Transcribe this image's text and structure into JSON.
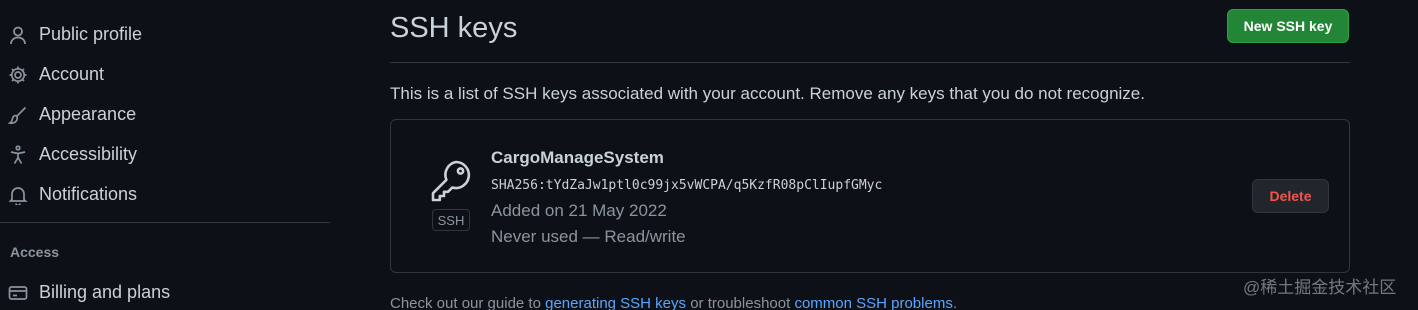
{
  "sidebar": {
    "items": [
      {
        "label": "Public profile",
        "icon": "person-icon"
      },
      {
        "label": "Account",
        "icon": "gear-icon"
      },
      {
        "label": "Appearance",
        "icon": "paintbrush-icon"
      },
      {
        "label": "Accessibility",
        "icon": "accessibility-icon"
      },
      {
        "label": "Notifications",
        "icon": "bell-icon"
      }
    ],
    "access_heading": "Access",
    "access_items": [
      {
        "label": "Billing and plans",
        "icon": "credit-card-icon"
      }
    ]
  },
  "main": {
    "title": "SSH keys",
    "new_key_label": "New SSH key",
    "intro": "This is a list of SSH keys associated with your account. Remove any keys that you do not recognize.",
    "keys": [
      {
        "title": "CargoManageSystem",
        "fingerprint": "SHA256:tYdZaJw1ptl0c99jx5vWCPA/q5KzfR08pClIupfGMyc",
        "added": "Added on 21 May 2022",
        "usage": "Never used — Read/write",
        "badge": "SSH",
        "delete_label": "Delete"
      }
    ],
    "footer": {
      "prefix": "Check out our guide to ",
      "link1": "generating SSH keys",
      "middle": " or troubleshoot ",
      "link2": "common SSH problems",
      "suffix": "."
    }
  },
  "watermark": "@稀土掘金技术社区",
  "colors": {
    "background": "#0d1117",
    "primary_button": "#238636",
    "danger_text": "#f85149",
    "link": "#58a6ff"
  }
}
